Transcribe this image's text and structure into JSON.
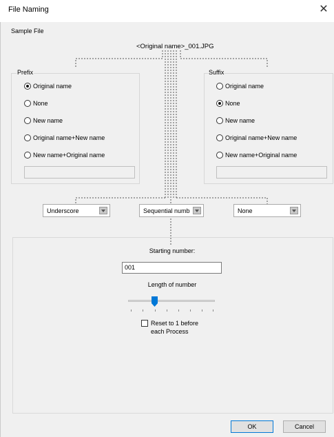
{
  "window": {
    "title": "File Naming",
    "close_glyph": "✕"
  },
  "sample": {
    "label": "Sample File",
    "value": "<Original name>_001.JPG"
  },
  "prefix": {
    "label": "Prefix",
    "options": [
      "Original name",
      "None",
      "New name",
      "Original name+New name",
      "New name+Original name"
    ],
    "selected": 0,
    "text_value": ""
  },
  "suffix": {
    "label": "Suffix",
    "options": [
      "Original name",
      "None",
      "New name",
      "Original name+New name",
      "New name+Original name"
    ],
    "selected": 1,
    "text_value": ""
  },
  "combos": {
    "separator": "Underscore",
    "numbering": "Sequential numb",
    "third": "None"
  },
  "numbering": {
    "start_label": "Starting number:",
    "start_value": "001",
    "length_label": "Length of number",
    "length_level": 0.3,
    "reset_label_line1": "Reset to 1 before",
    "reset_label_line2": "each Process",
    "reset_checked": false
  },
  "buttons": {
    "ok": "OK",
    "cancel": "Cancel"
  }
}
